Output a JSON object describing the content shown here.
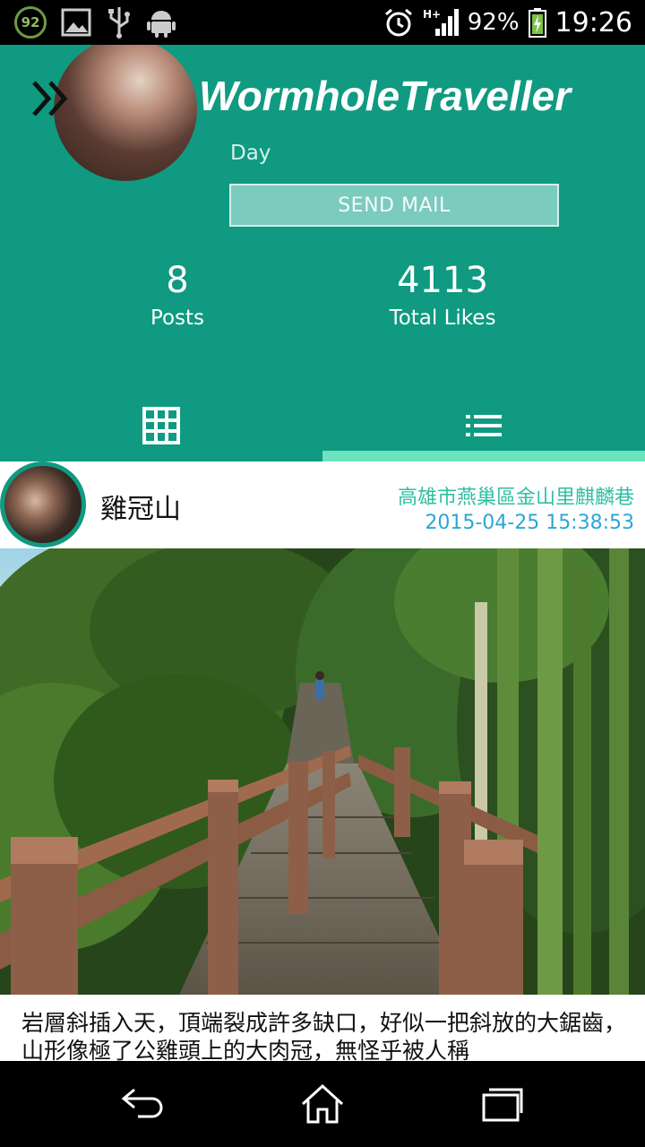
{
  "status_bar": {
    "notification_count": "92",
    "network": "H+",
    "battery_percent": "92%",
    "time": "19:26",
    "icons": [
      "counter-icon",
      "image-icon",
      "usb-icon",
      "android-icon",
      "alarm-icon",
      "signal-icon",
      "battery-icon"
    ]
  },
  "header": {
    "app_title": "WormholeTraveller",
    "subtitle": "Day",
    "send_mail_label": "SEND MAIL",
    "stats": {
      "posts_value": "8",
      "posts_label": "Posts",
      "likes_value": "4113",
      "likes_label": "Total Likes"
    },
    "tabs": [
      {
        "name": "grid",
        "icon": "grid-icon",
        "active": false
      },
      {
        "name": "list",
        "icon": "list-icon",
        "active": true
      }
    ]
  },
  "post": {
    "title": "雞冠山",
    "location": "高雄市燕巢區金山里麒麟巷",
    "datetime": "2015-04-25 15:38:53",
    "caption": "岩層斜插入天，頂端裂成許多缺口，好似一把斜放的大鋸齒，山形像極了公雞頭上的大肉冠，無怪乎被人稱"
  },
  "nav_bar": {
    "icons": [
      "back-icon",
      "home-icon",
      "recents-icon"
    ]
  },
  "colors": {
    "primary": "#0f9a81",
    "tab_indicator": "#6de2bf",
    "location_text": "#2fbfa3",
    "date_text": "#2aa7d6"
  }
}
